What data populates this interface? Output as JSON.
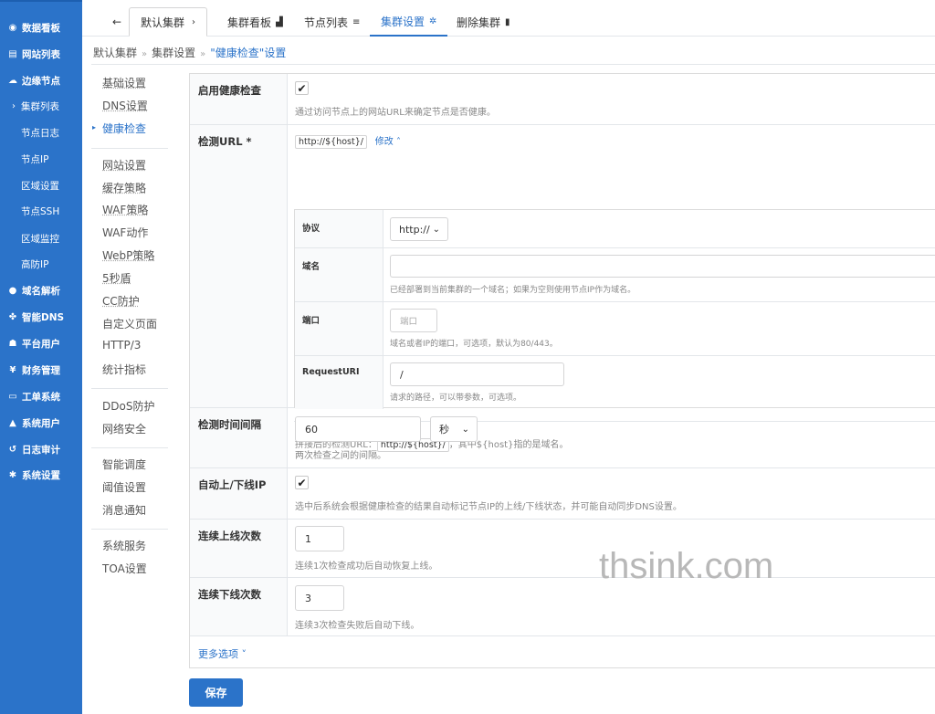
{
  "nav": {
    "items": [
      {
        "label": "数据看板",
        "icon": "dashboard-icon",
        "glyph": "◉"
      },
      {
        "label": "网站列表",
        "icon": "website-icon",
        "glyph": "▤"
      },
      {
        "label": "边缘节点",
        "icon": "cloud-icon",
        "glyph": "☁"
      },
      {
        "label": "集群列表",
        "icon": "chevron-right-icon",
        "glyph": "›"
      },
      {
        "label": "节点日志"
      },
      {
        "label": "节点IP"
      },
      {
        "label": "区域设置"
      },
      {
        "label": "节点SSH"
      },
      {
        "label": "区域监控"
      },
      {
        "label": "高防IP"
      },
      {
        "label": "域名解析",
        "icon": "globe-icon",
        "glyph": "●"
      },
      {
        "label": "智能DNS",
        "icon": "network-icon",
        "glyph": "✤"
      },
      {
        "label": "平台用户",
        "icon": "users-icon",
        "glyph": "☗"
      },
      {
        "label": "财务管理",
        "icon": "yen-icon",
        "glyph": "¥"
      },
      {
        "label": "工单系统",
        "icon": "ticket-icon",
        "glyph": "▭"
      },
      {
        "label": "系统用户",
        "icon": "user-lock-icon",
        "glyph": "▲"
      },
      {
        "label": "日志审计",
        "icon": "history-icon",
        "glyph": "↺"
      },
      {
        "label": "系统设置",
        "icon": "gear-icon",
        "glyph": "✱"
      }
    ]
  },
  "tabs": {
    "back_glyph": "←",
    "cluster": "默认集群",
    "cluster_glyph": "›",
    "board": "集群看板",
    "board_glyph": "▟",
    "nodes": "节点列表",
    "nodes_glyph": "≡",
    "settings": "集群设置",
    "settings_glyph": "✲",
    "delete": "删除集群",
    "delete_glyph": "▮"
  },
  "breadcrumb": {
    "sep": "»",
    "part1": "默认集群",
    "part2": "集群设置",
    "current": "\"健康检查\"设置"
  },
  "side_menu": {
    "group1": [
      "基础设置",
      "DNS设置",
      "健康检查"
    ],
    "group2": [
      "网站设置",
      "缓存策略",
      "WAF策略",
      "WAF动作",
      "WebP策略",
      "5秒盾",
      "CC防护",
      "自定义页面",
      "HTTP/3",
      "统计指标"
    ],
    "group3": [
      "DDoS防护",
      "网络安全"
    ],
    "group4": [
      "智能调度",
      "阈值设置",
      "消息通知"
    ],
    "group5": [
      "系统服务",
      "TOA设置"
    ],
    "active_marker": "▸"
  },
  "form": {
    "enable": {
      "label": "启用健康检查",
      "checked": "✔",
      "desc": "通过访问节点上的网站URL来确定节点是否健康。"
    },
    "url": {
      "label": "检测URL *",
      "value": "http://${host}/",
      "modify": "修改",
      "modify_glyph": "˄",
      "protocol_label": "协议",
      "protocol_value": "http://",
      "domain_label": "域名",
      "domain_value": "",
      "domain_desc": "已经部署到当前集群的一个域名；如果为空则使用节点IP作为域名。",
      "port_label": "端口",
      "port_placeholder": "端口",
      "port_desc": "域名或者IP的端口，可选项，默认为80/443。",
      "uri_label": "RequestURI",
      "uri_value": "/",
      "uri_desc": "请求的路径，可以带参数，可选项。",
      "combined_prefix": "拼接后的检测URL：",
      "combined_value": "http://${host}/",
      "combined_suffix": "，其中${host}指的是域名。"
    },
    "interval": {
      "label": "检测时间间隔",
      "value": "60",
      "unit": "秒",
      "desc": "两次检查之间的间隔。"
    },
    "auto_ip": {
      "label": "自动上/下线IP",
      "checked": "✔",
      "desc": "选中后系统会根据健康检查的结果自动标记节点IP的上线/下线状态，并可能自动同步DNS设置。"
    },
    "online": {
      "label": "连续上线次数",
      "value": "1",
      "desc": "连续1次检查成功后自动恢复上线。"
    },
    "offline": {
      "label": "连续下线次数",
      "value": "3",
      "desc": "连续3次检查失败后自动下线。"
    },
    "more": "更多选项",
    "more_glyph": "˅"
  },
  "save_label": "保存",
  "dropdown_glyph": "⌄",
  "watermark": "thsink.com"
}
